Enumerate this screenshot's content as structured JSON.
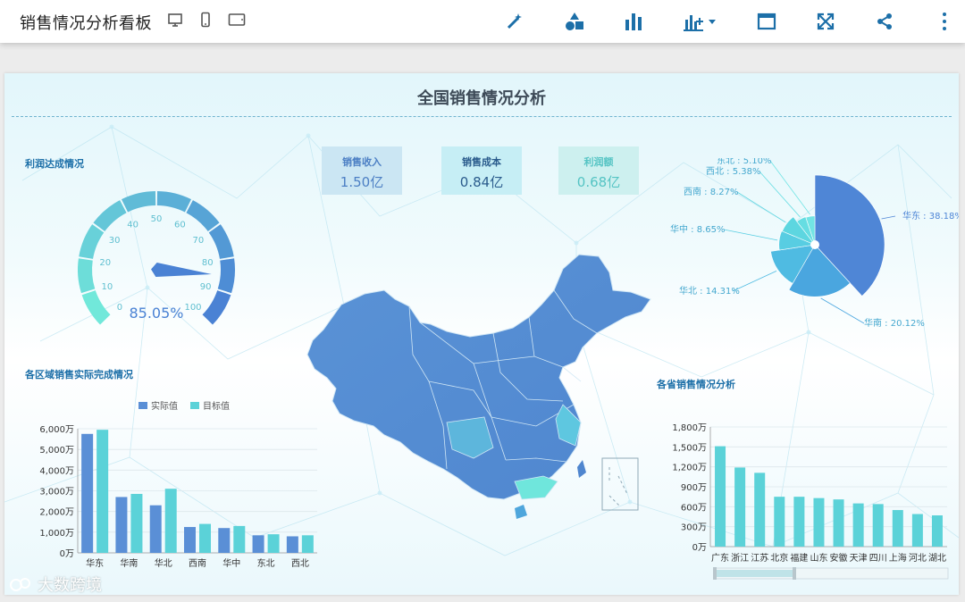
{
  "app": {
    "title": "销售情况分析看板"
  },
  "toolbar": {
    "view_icons": [
      "desktop-icon",
      "phone-icon",
      "tablet-icon"
    ],
    "tools": [
      "magic-wand-icon",
      "shapes-icon",
      "bar-chart-icon",
      "add-chart-icon",
      "layout-icon",
      "fullscreen-icon",
      "share-icon",
      "more-icon"
    ]
  },
  "dashboard": {
    "title": "全国销售情况分析",
    "gauge_title": "利润达成情况",
    "region_title": "各区域销售实际完成情况",
    "province_title": "各省销售情况分析"
  },
  "kpis": [
    {
      "label": "销售收入",
      "value": "1.50亿",
      "color": "#4c7fc4",
      "bg": "#cbe6f3"
    },
    {
      "label": "销售成本",
      "value": "0.84亿",
      "color": "#2a5b8c",
      "bg": "#c6eef5"
    },
    {
      "label": "利润额",
      "value": "0.68亿",
      "color": "#55c4c4",
      "bg": "#cdf0ef"
    }
  ],
  "colors": {
    "blue": "#5a8fd6",
    "teal": "#5bd2d8",
    "mid": "#4aa6df",
    "accent": "#1c6fa8"
  },
  "chart_data": [
    {
      "type": "gauge",
      "value": 85.05,
      "display": "85.05%",
      "min": 0,
      "max": 100,
      "ticks": [
        "0",
        "10",
        "20",
        "30",
        "40",
        "50",
        "60",
        "70",
        "80",
        "90",
        "100"
      ]
    },
    {
      "type": "pie",
      "variant": "rose",
      "slices": [
        {
          "label": "华东 : 38.18%",
          "name": "华东",
          "value": 38.18
        },
        {
          "label": "华南 : 20.12%",
          "name": "华南",
          "value": 20.12
        },
        {
          "label": "华北 : 14.31%",
          "name": "华北",
          "value": 14.31
        },
        {
          "label": "华中 : 8.65%",
          "name": "华中",
          "value": 8.65
        },
        {
          "label": "西南 : 8.27%",
          "name": "西南",
          "value": 8.27
        },
        {
          "label": "西北 : 5.38%",
          "name": "西北",
          "value": 5.38
        },
        {
          "label": "东北 : 5.10%",
          "name": "东北",
          "value": 5.1
        }
      ]
    },
    {
      "type": "bar",
      "categories": [
        "华东",
        "华南",
        "华北",
        "西南",
        "华中",
        "东北",
        "西北"
      ],
      "series": [
        {
          "name": "实际值",
          "values": [
            5750,
            2700,
            2300,
            1250,
            1200,
            850,
            800
          ]
        },
        {
          "name": "目标值",
          "values": [
            5950,
            2850,
            3100,
            1400,
            1300,
            900,
            850
          ]
        }
      ],
      "ylim": [
        0,
        6000
      ],
      "yticks": [
        "0万",
        "1,000万",
        "2,000万",
        "3,000万",
        "4,000万",
        "5,000万",
        "6,000万"
      ]
    },
    {
      "type": "bar",
      "categories": [
        "广东",
        "浙江",
        "江苏",
        "北京",
        "福建",
        "山东",
        "安徽",
        "天津",
        "四川",
        "上海",
        "河北",
        "湖北"
      ],
      "values": [
        1510,
        1190,
        1110,
        750,
        750,
        730,
        710,
        650,
        640,
        550,
        490,
        470
      ],
      "ylim": [
        0,
        1800
      ],
      "yticks": [
        "0万",
        "300万",
        "600万",
        "900万",
        "1,200万",
        "1,500万",
        "1,800万"
      ]
    }
  ]
}
